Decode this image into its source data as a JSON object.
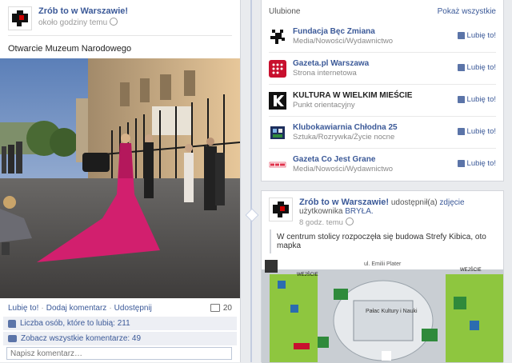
{
  "left_post": {
    "page_name": "Zrób to w Warszawie!",
    "time": "około godziny temu",
    "message": "Otwarcie Muzeum Narodowego",
    "actions": {
      "like": "Lubię to!",
      "comment": "Dodaj komentarz",
      "share": "Udostępnij",
      "separator": "·"
    },
    "comment_count": "20",
    "likes_text": "Liczba osób, które to lubią: 211",
    "view_comments": "Zobacz wszystkie komentarze: 49",
    "comment_placeholder": "Napisz komentarz…"
  },
  "likes_box": {
    "title": "Ulubione",
    "see_all": "Pokaż wszystkie",
    "like_label": "Lubię to!",
    "pages": [
      {
        "name": "Fundacja Bęc Zmiana",
        "category": "Media/Nowości/Wydawnictwo",
        "logo": "becz-icon"
      },
      {
        "name": "Gazeta.pl Warszawa",
        "category": "Strona internetowa",
        "logo": "gazeta-icon"
      },
      {
        "name": "KULTURA W WIELKIM MIEŚCIE",
        "category": "Punkt orientacyjny",
        "logo": "kwwm-icon"
      },
      {
        "name": "Klubokawiarnia Chłodna 25",
        "category": "Sztuka/Rozrywka/Życie nocne",
        "logo": "chlodna-icon"
      },
      {
        "name": "Gazeta Co Jest Grane",
        "category": "Media/Nowości/Wydawnictwo",
        "logo": "cojestgrane-icon"
      }
    ]
  },
  "shared_post": {
    "page_name": "Zrób to w Warszawie!",
    "shared_text": "udostępnił(a)",
    "photo_link": "zdjęcie",
    "user_text": "użytkownika",
    "user_name": "BRYŁA.",
    "time": "8 godz. temu",
    "message": "W centrum stolicy rozpoczęła się budowa Strefy Kibica, oto mapka",
    "map_labels": {
      "street": "ul. Emilii Plater",
      "entrance_1": "WEJŚCIE",
      "entrance_2": "WEJŚCIE",
      "palace": "Pałac Kultury i Nauki"
    }
  },
  "colors": {
    "brand_blue": "#3b5998",
    "dress_pink": "#d21f6e",
    "map_green": "#8ec63f"
  }
}
